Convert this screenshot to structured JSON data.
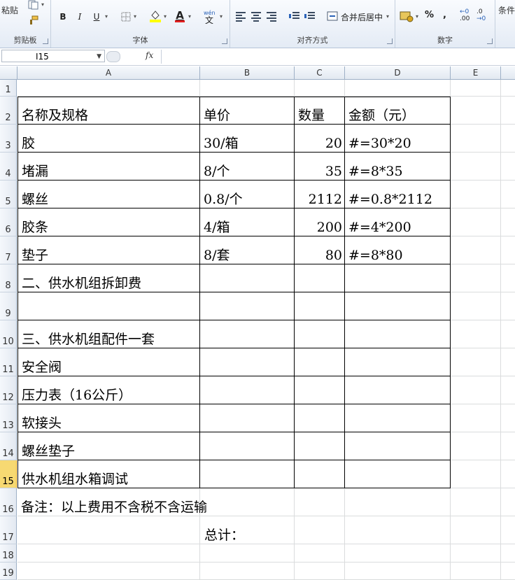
{
  "ribbon": {
    "clipboard": {
      "paste_label": "粘贴",
      "group_label": "剪贴板"
    },
    "font": {
      "bold": "B",
      "italic": "I",
      "underline": "U",
      "font_color_glyph": "A",
      "group_label": "字体"
    },
    "alignment": {
      "merge_label": "合并后居中",
      "group_label": "对齐方式"
    },
    "number": {
      "percent": "%",
      "comma": ",",
      "inc_decimal": ".00",
      "dec_decimal": ".0",
      "group_label": "数字"
    },
    "partial_group_label": "条件"
  },
  "formula_bar": {
    "name_box": "I15",
    "fx": "fx",
    "formula": ""
  },
  "columns": [
    "A",
    "B",
    "C",
    "D",
    "E"
  ],
  "rows": [
    "1",
    "2",
    "3",
    "4",
    "5",
    "6",
    "7",
    "8",
    "9",
    "10",
    "11",
    "12",
    "13",
    "14",
    "15",
    "16",
    "17",
    "18",
    "19"
  ],
  "active_row": "15",
  "cells": {
    "A2": "名称及规格",
    "B2": "单价",
    "C2": "数量",
    "D2": "金额（元）",
    "A3": "胶",
    "B3": "30/箱",
    "C3": "20",
    "D3": "#=30*20",
    "A4": "堵漏",
    "B4": "8/个",
    "C4": "35",
    "D4": "#=8*35",
    "A5": "螺丝",
    "B5": "0.8/个",
    "C5": "2112",
    "D5": "#=0.8*2112",
    "A6": "胶条",
    "B6": "4/箱",
    "C6": "200",
    "D6": "#=4*200",
    "A7": "垫子",
    "B7": "8/套",
    "C7": "80",
    "D7": "#=8*80",
    "A8": "二、供水机组拆卸费",
    "A10": "三、供水机组配件一套",
    "A11": "安全阀",
    "A12": "压力表（16公斤）",
    "A13": "软接头",
    "A14": "螺丝垫子",
    "A15": "供水机组水箱调试",
    "A16": "备注：以上费用不含税不含运输",
    "B17": "总计："
  },
  "colors": {
    "active_row_header": "#f7d972",
    "grid": "#dadcdd",
    "header_bg": "#e3e9f1"
  }
}
